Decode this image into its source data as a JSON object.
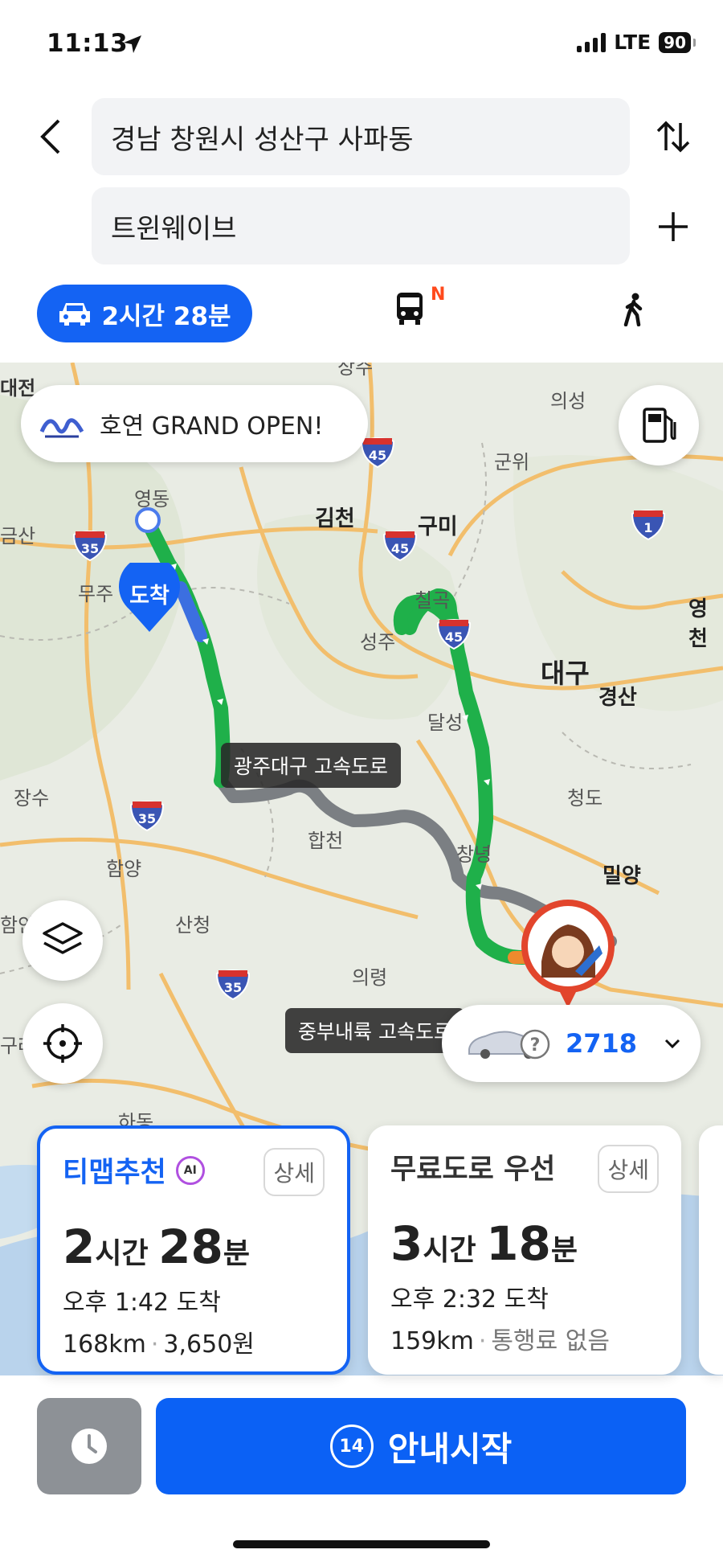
{
  "status": {
    "time": "11:13",
    "network": "LTE",
    "battery": "90"
  },
  "header": {
    "origin": "경남 창원시 성산구 사파동",
    "destination": "트윈웨이브",
    "back_icon": "chevron-left-icon",
    "swap_icon": "swap-vertical-icon",
    "add_icon": "plus-icon"
  },
  "modes": {
    "car_label": "2시간 28분",
    "bus_badge": "N",
    "walk_icon": "walk-icon"
  },
  "map": {
    "promo_logo": "호연",
    "promo_text": "호연 GRAND OPEN!",
    "dest_pin_label": "도착",
    "road_label_1": "광주대구 고속도로",
    "road_label_2": "중부내륙 고속도로",
    "vehicle_code": "2718",
    "places": [
      {
        "name": "대전"
      },
      {
        "name": "의성"
      },
      {
        "name": "군위"
      },
      {
        "name": "영동"
      },
      {
        "name": "김천"
      },
      {
        "name": "구미"
      },
      {
        "name": "금산"
      },
      {
        "name": "무주"
      },
      {
        "name": "칠곡"
      },
      {
        "name": "영천"
      },
      {
        "name": "성주"
      },
      {
        "name": "대구"
      },
      {
        "name": "경산"
      },
      {
        "name": "달성"
      },
      {
        "name": "장수"
      },
      {
        "name": "청도"
      },
      {
        "name": "합천"
      },
      {
        "name": "창녕"
      },
      {
        "name": "함양"
      },
      {
        "name": "밀양"
      },
      {
        "name": "산청"
      },
      {
        "name": "함안"
      },
      {
        "name": "의령"
      },
      {
        "name": "구례"
      },
      {
        "name": "하동"
      },
      {
        "name": "상주"
      }
    ],
    "shields": [
      "45",
      "35",
      "45",
      "1",
      "45",
      "35",
      "35"
    ]
  },
  "routes": [
    {
      "title": "티맵추천",
      "ai_badge": "AI",
      "detail_label": "상세",
      "duration_h": "2",
      "duration_h_unit": "시간",
      "duration_m": "28",
      "duration_m_unit": "분",
      "arrival": "오후 1:42 도착",
      "distance": "168km",
      "toll": "3,650원"
    },
    {
      "title": "무료도로 우선",
      "detail_label": "상세",
      "duration_h": "3",
      "duration_h_unit": "시간",
      "duration_m": "18",
      "duration_m_unit": "분",
      "arrival": "오후 2:32 도착",
      "distance": "159km",
      "toll": "통행료 없음"
    }
  ],
  "bottom": {
    "start_label": "안내시작",
    "countdown": "14"
  },
  "colors": {
    "primary": "#1463f3",
    "route_green": "#1fb04a",
    "route_gray": "#7b7f83"
  }
}
